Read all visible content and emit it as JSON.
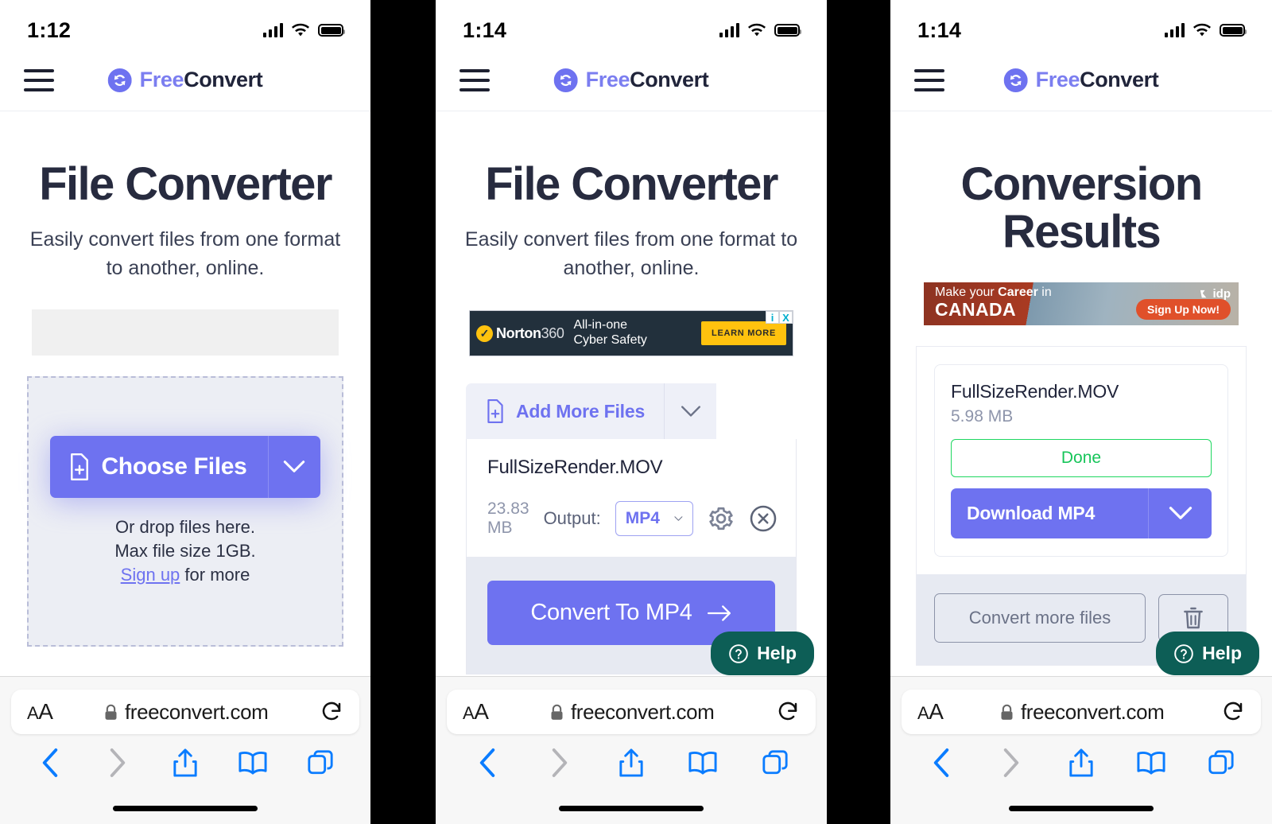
{
  "brand": {
    "name_part1": "Free",
    "name_part2": "Convert",
    "logo_icon": "sync-circle-icon",
    "accent": "#6e72f0"
  },
  "panels": [
    {
      "id": "panel-upload",
      "status_bar": {
        "time": "1:12",
        "signal_icon": "cellular-signal-icon",
        "wifi_icon": "wifi-icon",
        "battery_icon": "battery-full-icon"
      },
      "page": {
        "title": "File Converter",
        "subtitle": "Easily convert files from one format to another, online.",
        "ad": {
          "type": "empty-placeholder"
        },
        "dropzone": {
          "choose_files_label": "Choose Files",
          "choose_files_icon": "file-add-icon",
          "caret_icon": "chevron-down-icon",
          "line1": "Or drop files here.",
          "line2": "Max file size 1GB.",
          "signup_link": "Sign up",
          "line3_suffix": " for more"
        }
      },
      "safari": {
        "text_size_label": "AA",
        "lock_icon": "lock-icon",
        "url": "freeconvert.com",
        "reload_icon": "reload-icon",
        "back_icon": "chevron-left-icon",
        "forward_icon": "chevron-right-icon",
        "share_icon": "share-icon",
        "bookmarks_icon": "book-icon",
        "tabs_icon": "tabs-icon"
      }
    },
    {
      "id": "panel-convert",
      "status_bar": {
        "time": "1:14",
        "signal_icon": "cellular-signal-icon",
        "wifi_icon": "wifi-icon",
        "battery_icon": "battery-full-icon"
      },
      "page": {
        "title": "File Converter",
        "subtitle": "Easily convert files from one format to another, online.",
        "ad": {
          "type": "norton",
          "brand_bold": "Norton",
          "brand_light": "360",
          "check_icon": "check-badge-icon",
          "headline_line1": "All-in-one",
          "headline_line2": "Cyber Safety",
          "cta": "LEARN MORE",
          "info_icon": "adchoices-info-icon",
          "close_icon": "ad-close-icon",
          "close_label": "X",
          "info_label": "i"
        },
        "add_more_files": {
          "label": "Add More Files",
          "icon": "file-add-icon",
          "caret_icon": "chevron-down-icon"
        },
        "file": {
          "name": "FullSizeRender.MOV",
          "size": "23.83 MB",
          "output_label": "Output:",
          "output_format": "MP4",
          "output_caret_icon": "chevron-down-icon",
          "settings_icon": "gear-icon",
          "remove_icon": "close-circle-icon"
        },
        "convert_button": {
          "label": "Convert To MP4",
          "icon": "arrow-right-icon"
        }
      },
      "help": {
        "label": "Help",
        "icon": "question-circle-icon",
        "color": "#0d5e56"
      },
      "safari": {
        "text_size_label": "AA",
        "lock_icon": "lock-icon",
        "url": "freeconvert.com",
        "reload_icon": "reload-icon",
        "back_icon": "chevron-left-icon",
        "forward_icon": "chevron-right-icon",
        "share_icon": "share-icon",
        "bookmarks_icon": "book-icon",
        "tabs_icon": "tabs-icon"
      }
    },
    {
      "id": "panel-results",
      "status_bar": {
        "time": "1:14",
        "signal_icon": "cellular-signal-icon",
        "wifi_icon": "wifi-icon",
        "battery_icon": "battery-full-icon"
      },
      "page": {
        "title": "Conversion Results",
        "ad": {
          "type": "idp",
          "line1_plain_a": "Make your ",
          "line1_bold": "Career",
          "line1_plain_b": " in",
          "line2": "CANADA",
          "cta": "Sign Up Now!",
          "logo": "idp",
          "logo_icon": "idp-logo-icon"
        },
        "result": {
          "name": "FullSizeRender.MOV",
          "size": "5.98 MB",
          "status": "Done",
          "status_color": "#17c55a",
          "download_label": "Download MP4",
          "download_caret_icon": "chevron-down-icon"
        },
        "footer": {
          "convert_more_label": "Convert more files",
          "delete_icon": "trash-icon"
        }
      },
      "help": {
        "label": "Help",
        "icon": "question-circle-icon",
        "color": "#0d5e56"
      },
      "safari": {
        "text_size_label": "AA",
        "lock_icon": "lock-icon",
        "url": "freeconvert.com",
        "reload_icon": "reload-icon",
        "back_icon": "chevron-left-icon",
        "forward_icon": "chevron-right-icon",
        "share_icon": "share-icon",
        "bookmarks_icon": "book-icon",
        "tabs_icon": "tabs-icon"
      }
    }
  ]
}
